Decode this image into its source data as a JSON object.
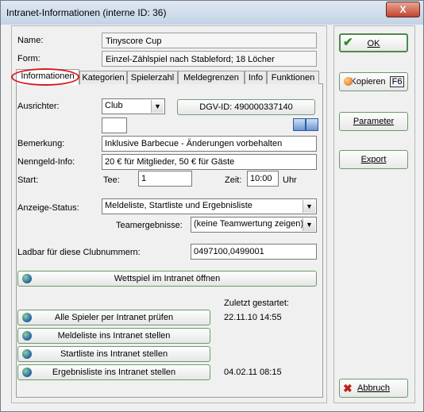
{
  "window": {
    "title": "Intranet-Informationen (interne ID: 36)",
    "close_glyph": "X"
  },
  "header": {
    "name_label": "Name:",
    "name_value": "Tinyscore Cup",
    "form_label": "Form:",
    "form_value": "Einzel-Zählspiel nach Stableford; 18 Löcher"
  },
  "tabs": [
    "Informationen",
    "Kategorien",
    "Spielerzahl",
    "Meldegrenzen",
    "Info",
    "Funktionen"
  ],
  "info": {
    "ausrichter_label": "Ausrichter:",
    "ausrichter_value": "Club",
    "dgv_button": "DGV-ID: 490000337140",
    "bemerkung_label": "Bemerkung:",
    "bemerkung_value": "Inklusive Barbecue - Änderungen vorbehalten",
    "nenngeld_label": "Nenngeld-Info:",
    "nenngeld_value": "20 € für Mitglieder, 50 € für Gäste",
    "start_label": "Start:",
    "tee_label": "Tee:",
    "tee_value": "1",
    "zeit_label": "Zeit:",
    "zeit_value": "10:00",
    "uhr_label": "Uhr",
    "anzeige_label": "Anzeige-Status:",
    "anzeige_value": "Meldeliste, Startliste und Ergebnisliste",
    "team_label": "Teamergebnisse:",
    "team_value": "(keine Teamwertung zeigen)",
    "ladbar_label": "Ladbar für diese Clubnummern:",
    "ladbar_value": "0497100,0499001",
    "open_button": "Wettspiel im Intranet öffnen",
    "zuletzt_label": "Zuletzt gestartet:",
    "actions": [
      {
        "label": "Alle Spieler per Intranet prüfen",
        "date": "22.11.10 14:55"
      },
      {
        "label": "Meldeliste ins Intranet stellen",
        "date": ""
      },
      {
        "label": "Startliste ins Intranet stellen",
        "date": ""
      },
      {
        "label": "Ergebnisliste ins Intranet stellen",
        "date": "04.02.11 08:15"
      }
    ]
  },
  "side": {
    "ok": "OK",
    "kopieren": "Kopieren",
    "kopieren_key": "F6",
    "parameter": "Parameter",
    "export": "Export",
    "abbruch": "Abbruch"
  },
  "colors": {
    "highlight_oval": "#d81818",
    "ok_check": "#2e8b2e",
    "abbruch_x": "#c0201a"
  }
}
